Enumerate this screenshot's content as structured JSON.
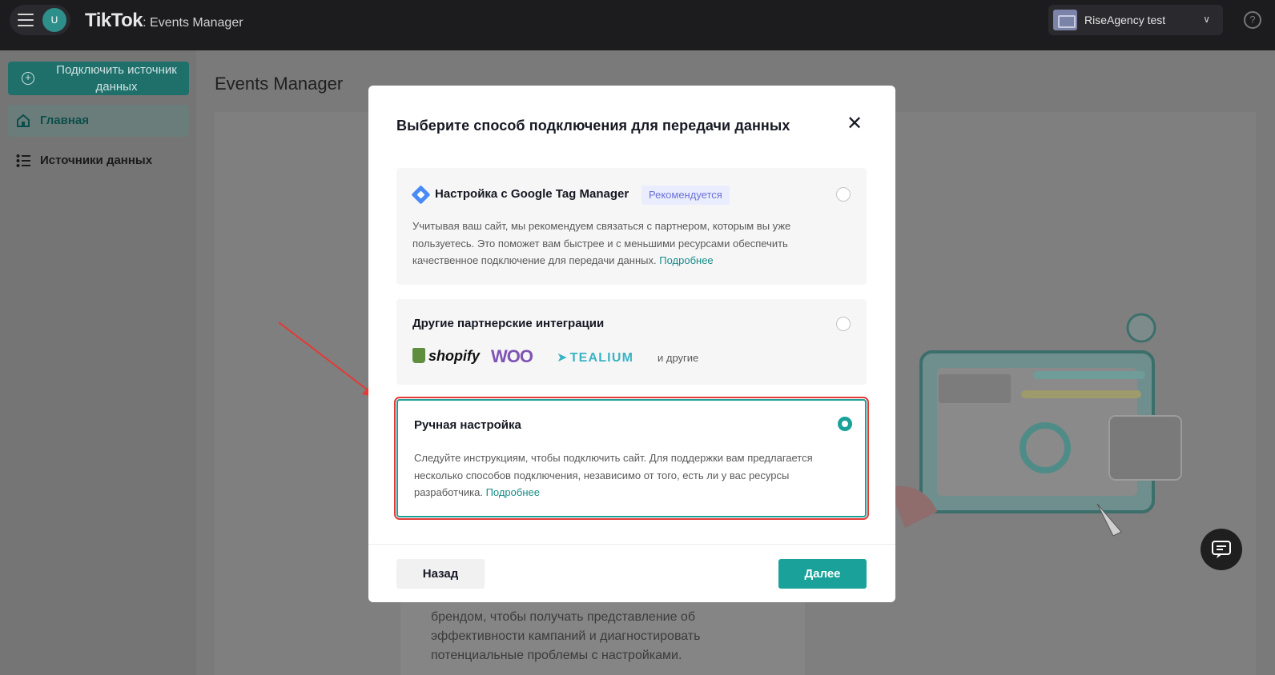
{
  "topbar": {
    "avatar_letter": "U",
    "brand": "TikTok",
    "brand_sub": "Events Manager",
    "account_name": "RiseAgency test",
    "help_symbol": "?"
  },
  "sidebar": {
    "connect_button": "Подключить источник данных",
    "items": [
      {
        "label": "Главная",
        "icon": "home-icon"
      },
      {
        "label": "Источники данных",
        "icon": "list-icon"
      }
    ]
  },
  "main": {
    "page_title": "Events Manager",
    "behind_text": "брендом, чтобы получать представление об эффективности кампаний и диагностировать потенциальные проблемы с настройками."
  },
  "modal": {
    "title": "Выберите способ подключения для передачи данных",
    "close_symbol": "✕",
    "options": [
      {
        "title": "Настройка с Google Tag Manager",
        "badge": "Рекомендуется",
        "description": "Учитывая ваш сайт, мы рекомендуем связаться с партнером, которым вы уже пользуетесь. Это поможет вам быстрее и с меньшими ресурсами обеспечить качественное подключение для передачи данных.",
        "link": "Подробнее",
        "selected": false
      },
      {
        "title": "Другие партнерские интеграции",
        "partners": [
          "shopify",
          "WOO",
          "TEALIUM"
        ],
        "others": "и другие",
        "selected": false
      },
      {
        "title": "Ручная настройка",
        "description": "Следуйте инструкциям, чтобы подключить сайт. Для поддержки вам предлагается несколько способов подключения, независимо от того, есть ли у вас ресурсы разработчика.",
        "link": "Подробнее",
        "selected": true
      }
    ],
    "back_button": "Назад",
    "next_button": "Далее"
  },
  "colors": {
    "accent": "#1aa19a",
    "badge_bg": "#eaedfd",
    "badge_text": "#6c72d8",
    "annotation_red": "#e53935"
  }
}
